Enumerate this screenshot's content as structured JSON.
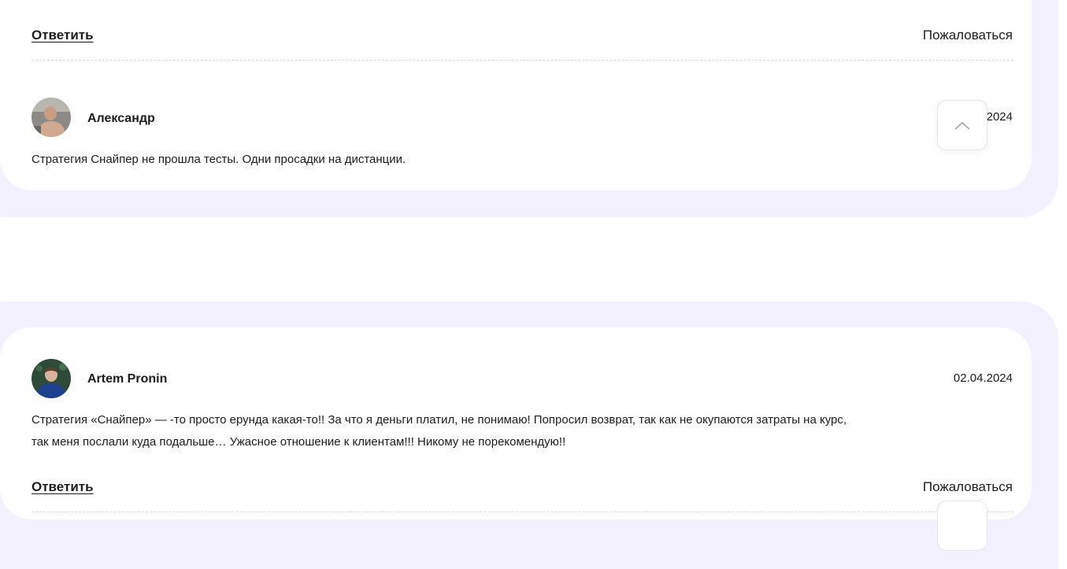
{
  "comment_top": {
    "reply_label": "Ответить",
    "complain_label": "Пожаловаться"
  },
  "comment_1": {
    "author": "Александр",
    "date_visible": "2024",
    "text": "Стратегия Снайпер не прошла тесты. Одни просадки на дистанции."
  },
  "comment_2": {
    "author": "Artem Pronin",
    "date": "02.04.2024",
    "text_line1": "Стратегия «Снайпер» — -то просто ерунда какая-то!! За что я деньги платил, не понимаю! Попросил возврат, так как не окупаются затраты на курс,",
    "text_line2": "так меня послали куда подальше… Ужасное отношение к клиентам!!! Никому не порекомендую!!",
    "reply_label": "Ответить",
    "complain_label": "Пожаловаться"
  },
  "colors": {
    "section_background": "#f3f1fd",
    "card_background": "#ffffff",
    "text": "#1d1d1f"
  },
  "icons": {
    "scroll_top": "chevron-up-icon"
  }
}
